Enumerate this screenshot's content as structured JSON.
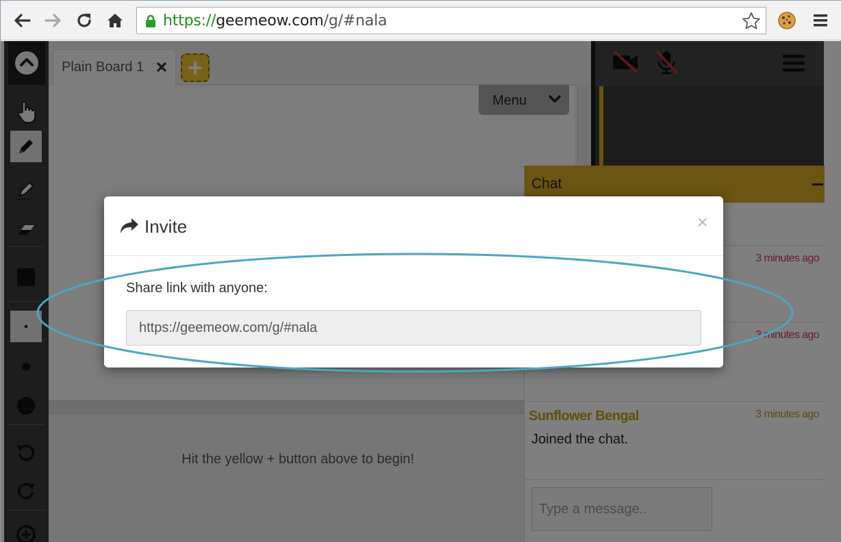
{
  "browser": {
    "url_scheme": "https://",
    "url_host": "geemeow.com",
    "url_path": "/g/#nala",
    "icons": [
      "back-arrow-icon",
      "forward-arrow-icon",
      "reload-icon",
      "home-icon",
      "lock-icon",
      "star-icon",
      "cookie-icon",
      "hamburger-menu-icon"
    ]
  },
  "toolbar": {
    "icons": [
      "collapse-up-icon",
      "hand-pointer-icon",
      "pencil-icon",
      "highlighter-icon",
      "eraser-icon",
      "filled-square-icon",
      "small-dot-icon",
      "medium-dot-icon",
      "large-dot-icon",
      "undo-icon",
      "redo-icon",
      "zoom-in-icon"
    ],
    "active_tools": [
      "pencil-icon",
      "small-dot-icon"
    ]
  },
  "board": {
    "tab_label": "Plain Board 1",
    "add_button_symbol": "+",
    "menu_label": "Menu",
    "hint": "Hit the yellow + button above to begin!"
  },
  "video": {
    "icons": [
      "video-off-icon",
      "mic-off-icon",
      "hamburger-menu-icon"
    ]
  },
  "chat": {
    "title": "Chat",
    "messages": [
      {
        "time": "3 minutes ago",
        "type": "user"
      },
      {
        "time": "3 minutes ago",
        "type": "user"
      },
      {
        "name": "Sunflower Bengal",
        "time": "3 minutes ago",
        "text": "Joined the chat.",
        "type": "system"
      }
    ],
    "input_placeholder": "Type a message.."
  },
  "modal": {
    "title": "Invite",
    "close_symbol": "×",
    "share_label": "Share link with anyone:",
    "share_link": "https://geemeow.com/g/#nala"
  },
  "colors": {
    "accent_yellow": "#d9a826",
    "url_green": "#1e8f1e",
    "time_pink": "#e02f7a",
    "annotation_teal": "#4aa8c0",
    "backdrop": "rgba(0,0,0,0.5)"
  }
}
